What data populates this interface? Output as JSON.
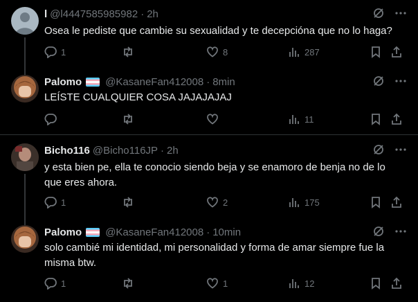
{
  "tweets": [
    {
      "name": "l",
      "handle": "@l4447585985982",
      "time": "2h",
      "has_flag": false,
      "text": "Osea le pediste que cambie su sexualidad y te decepcióna que no lo haga?",
      "replies": "1",
      "retweets": "",
      "likes": "8",
      "views": "287"
    },
    {
      "name": "Palomo",
      "handle": "@KasaneFan412008",
      "time": "8min",
      "has_flag": true,
      "text": "LEÍSTE CUALQUIER COSA JAJAJAJAJ",
      "replies": "",
      "retweets": "",
      "likes": "",
      "views": "11"
    },
    {
      "name": "Bicho116",
      "handle": "@Bicho116JP",
      "time": "2h",
      "has_flag": false,
      "text": "y esta bien  pe, ella te conocio siendo beja y se enamoro de benja no de lo que eres ahora.",
      "replies": "1",
      "retweets": "",
      "likes": "2",
      "views": "175"
    },
    {
      "name": "Palomo",
      "handle": "@KasaneFan412008",
      "time": "10min",
      "has_flag": true,
      "text": "solo cambié mi identidad, mi personalidad y forma de amar siempre fue la misma btw.",
      "replies": "1",
      "retweets": "",
      "likes": "1",
      "views": "12"
    }
  ],
  "icons": [
    "grok-icon",
    "more-icon",
    "reply-icon",
    "retweet-icon",
    "like-icon",
    "views-icon",
    "bookmark-icon",
    "share-icon"
  ],
  "colors": {
    "background": "#000000",
    "text": "#e7e9ea",
    "muted": "#71767b",
    "divider": "#2f3336"
  }
}
